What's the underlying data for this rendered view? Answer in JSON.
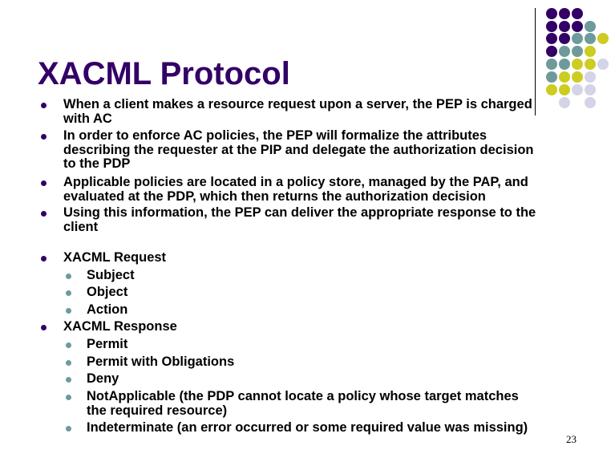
{
  "slide": {
    "title": "XACML Protocol",
    "page_number": "23",
    "colors": {
      "title": "#330066",
      "main_bullet": "#330066",
      "sub_bullet": "#6e9a9c",
      "text": "#000000",
      "dot_purple": "#330066",
      "dot_teal": "#6e9a9c",
      "dot_yellow": "#cccc22",
      "dot_lavender": "#d4d4e8"
    },
    "decoration": {
      "dot_pattern": [
        [
          "P",
          "P",
          "P",
          "_",
          "_"
        ],
        [
          "P",
          "P",
          "P",
          "T",
          "_"
        ],
        [
          "P",
          "P",
          "T",
          "T",
          "Y"
        ],
        [
          "P",
          "T",
          "T",
          "Y",
          "_"
        ],
        [
          "T",
          "T",
          "Y",
          "Y",
          "L"
        ],
        [
          "T",
          "Y",
          "Y",
          "L",
          "_"
        ],
        [
          "Y",
          "Y",
          "L",
          "L",
          "_"
        ],
        [
          "_",
          "L",
          "_",
          "L",
          "_"
        ]
      ]
    },
    "bullets": [
      {
        "level": 1,
        "lines": [
          "When a client makes a resource request upon a server, the PEP is charged",
          "with AC"
        ]
      },
      {
        "level": 1,
        "lines": [
          "In order to enforce AC policies, the PEP will formalize the attributes",
          "describing the requester at the PIP and delegate the authorization decision",
          "to the PDP"
        ]
      },
      {
        "level": 1,
        "lines": [
          "Applicable policies are located in a policy store, managed by the PAP, and",
          "evaluated at the PDP, which then returns the authorization decision"
        ]
      },
      {
        "level": 1,
        "lines": [
          "Using this information, the PEP can deliver the appropriate response to the",
          "client"
        ]
      },
      {
        "level": 1,
        "lines": [
          "XACML Request"
        ]
      },
      {
        "level": 2,
        "lines": [
          "Subject"
        ]
      },
      {
        "level": 2,
        "lines": [
          "Object"
        ]
      },
      {
        "level": 2,
        "lines": [
          "Action"
        ]
      },
      {
        "level": 1,
        "lines": [
          "XACML Response"
        ]
      },
      {
        "level": 2,
        "lines": [
          "Permit"
        ]
      },
      {
        "level": 2,
        "lines": [
          "Permit with Obligations"
        ]
      },
      {
        "level": 2,
        "lines": [
          "Deny"
        ]
      },
      {
        "level": 2,
        "lines": [
          "NotApplicable (the PDP cannot locate a policy whose target matches",
          "the required resource)"
        ]
      },
      {
        "level": 2,
        "lines": [
          "Indeterminate (an error occurred or some required value was missing)"
        ]
      }
    ]
  }
}
